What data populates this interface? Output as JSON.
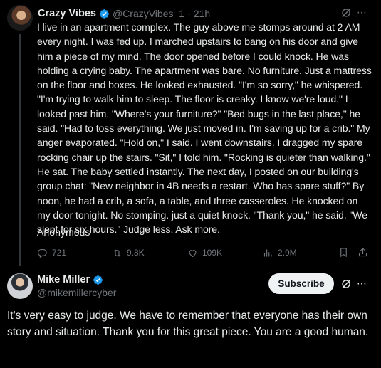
{
  "post": {
    "author_name": "Crazy Vibes",
    "handle": "@CrazyVibes_1",
    "separator": "·",
    "time": "21h",
    "text": "I live in an apartment complex. The guy above me stomps around at 2 AM every night. I was fed up. I marched upstairs to bang on his door and give him a piece of my mind. The door opened before I could knock. He was holding a crying baby. The apartment was bare. No furniture. Just a mattress on the floor and boxes. He looked exhausted. \"I'm so sorry,\" he whispered. \"I'm trying to walk him to sleep. The floor is creaky. I know we're loud.\" I looked past him. \"Where's your furniture?\" \"Bed bugs in the last place,\" he said. \"Had to toss everything. We just moved in. I'm saving up for a crib.\" My anger evaporated. \"Hold on,\" I said. I went downstairs. I dragged my spare rocking chair up the stairs. \"Sit,\" I told him. \"Rocking is quieter than walking.\" He sat. The baby settled instantly. The next day, I posted on our building's group chat: \"New neighbor in 4B needs a restart. Who has spare stuff?\" By noon, he had a crib, a sofa, a table, and three casseroles. He knocked on my door tonight. No stomping. just a quiet knock. \"Thank you,\" he said. \"We slept for six hours.\" Judge less. Ask more.",
    "signoff": "Anonymous",
    "stats": {
      "replies": "721",
      "reposts": "9.8K",
      "likes": "109K",
      "views": "2.9M"
    }
  },
  "reply": {
    "author_name": "Mike Miller",
    "handle": "@mikemillercyber",
    "subscribe_label": "Subscribe",
    "text": "It's very easy to judge.  We have to remember that everyone has their own story and situation.  Thank you for this great piece.  You are a good human."
  },
  "icons": {
    "more": "⋯"
  },
  "colors": {
    "background": "#000000",
    "text": "#e7e9ea",
    "muted": "#71767b",
    "verified": "#1d9bf0"
  }
}
